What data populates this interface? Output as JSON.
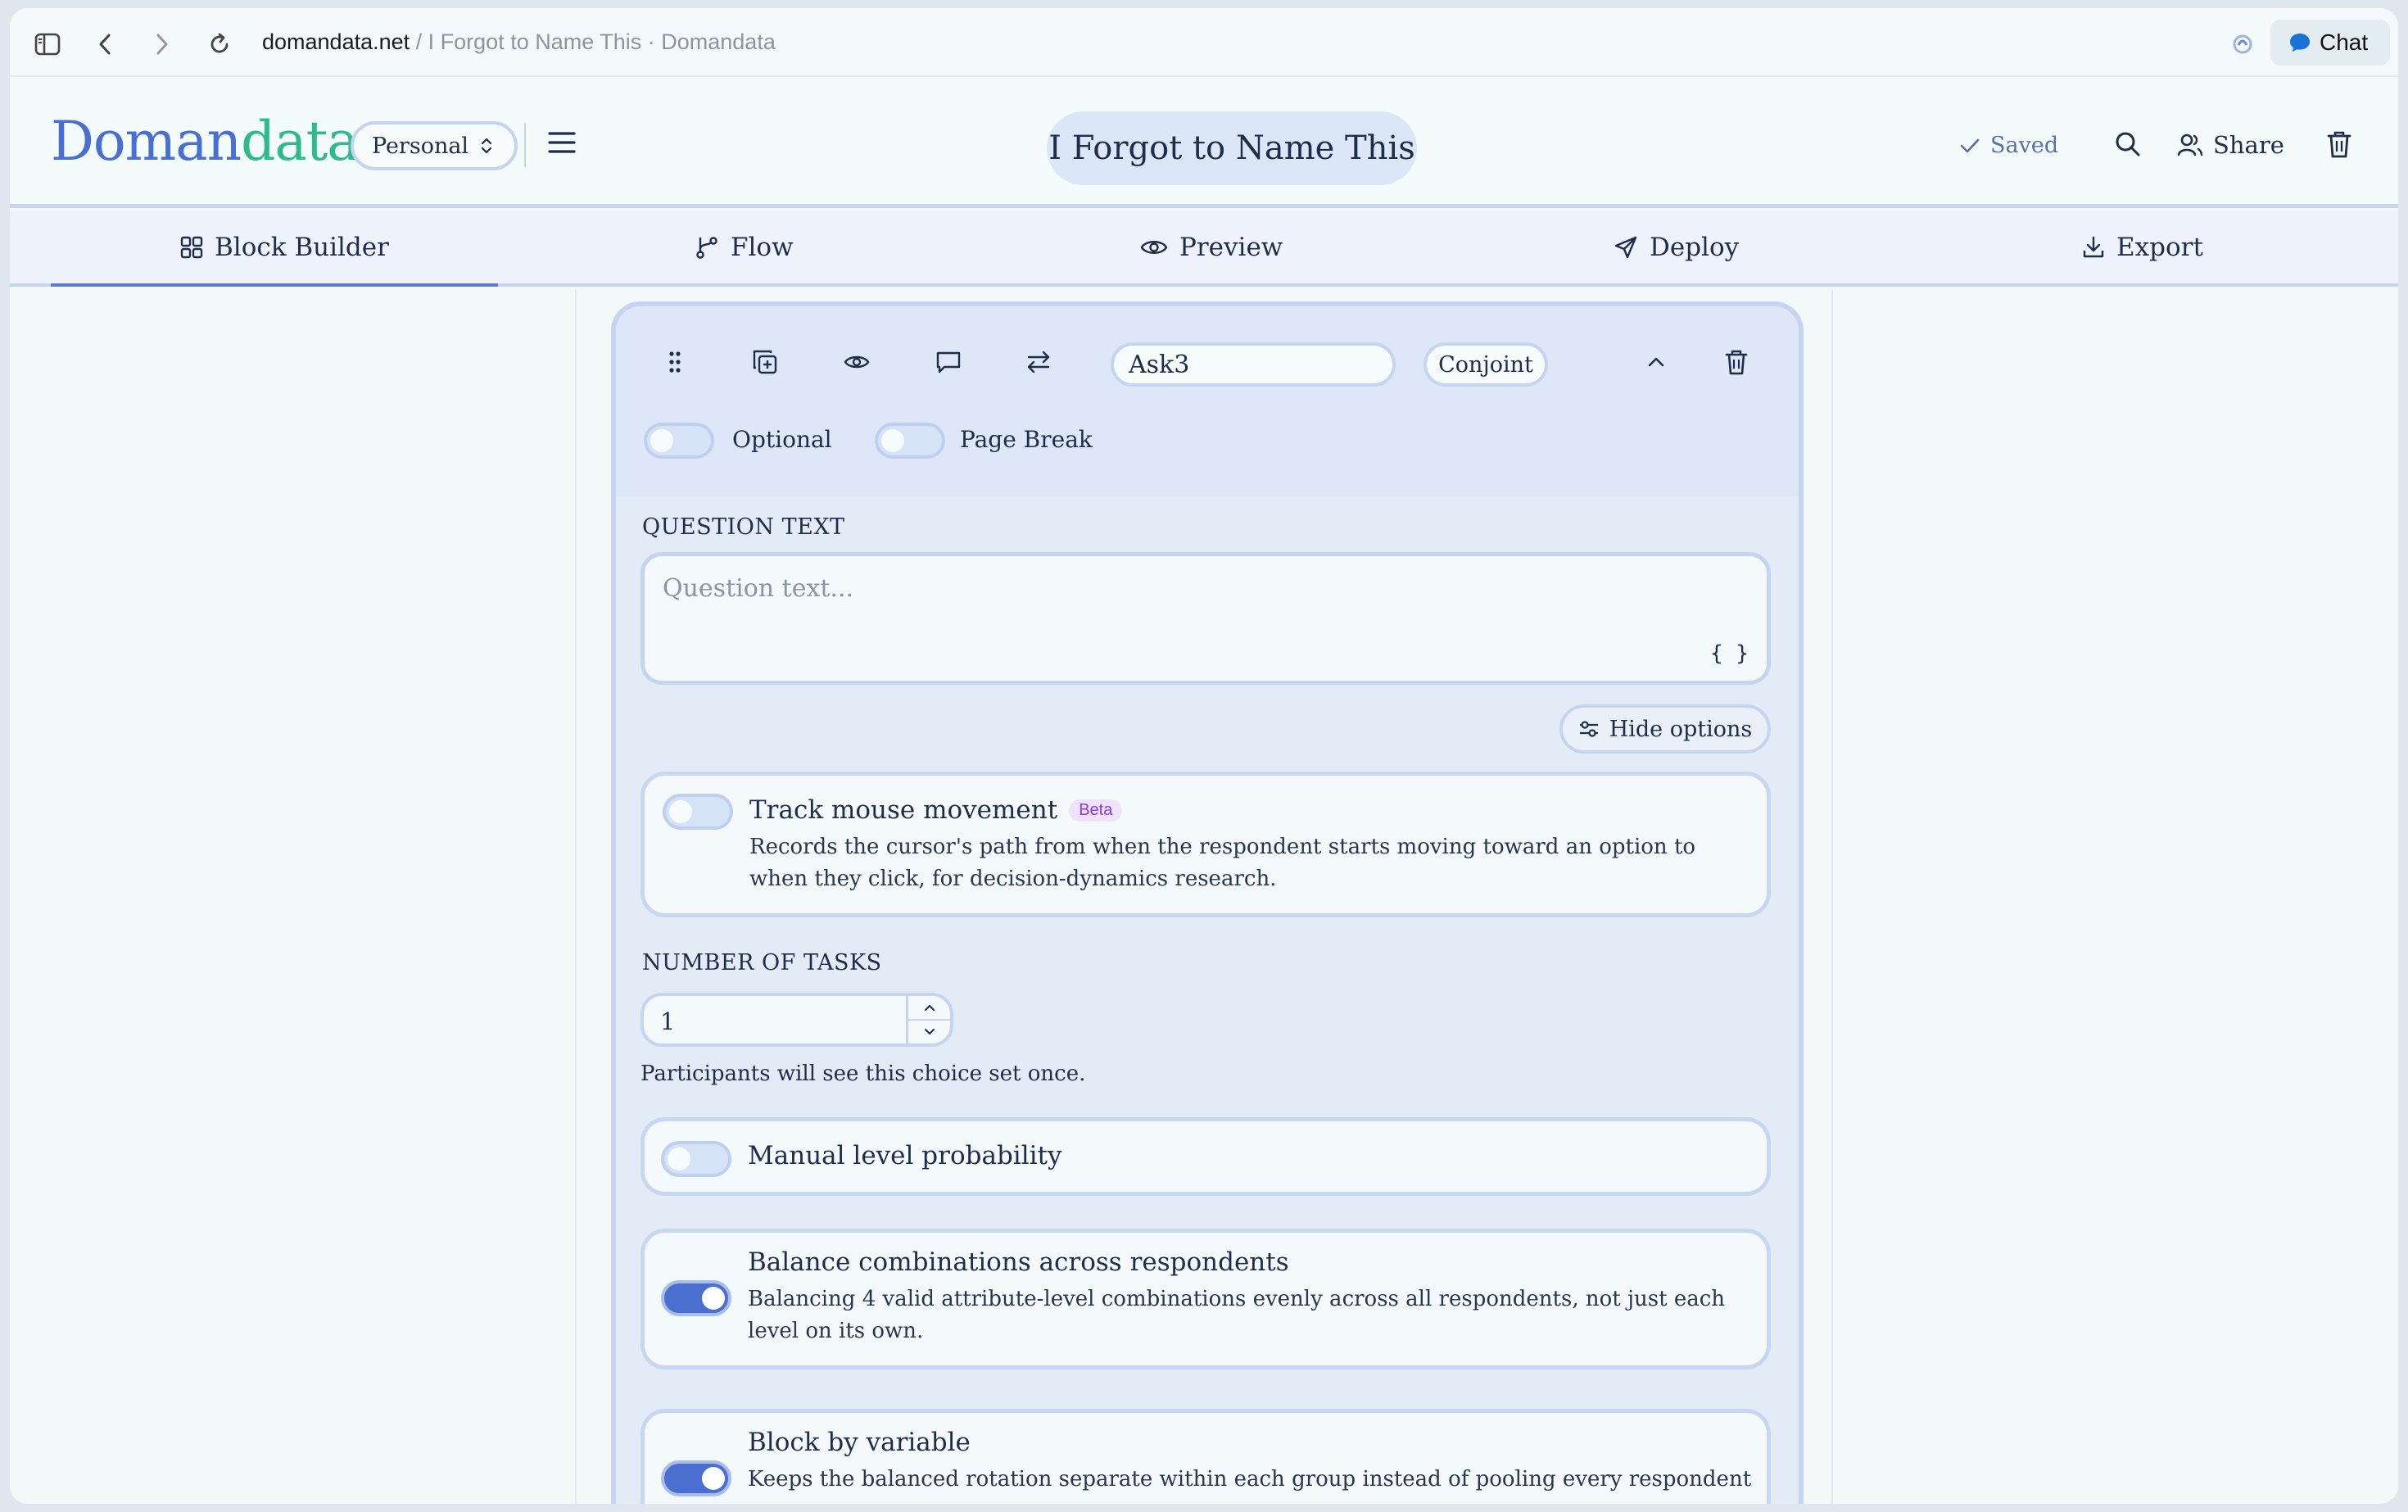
{
  "browser": {
    "url_domain": "domandata.net",
    "url_separator": " / ",
    "url_rest": "I Forgot to Name This · Domandata",
    "chat_label": "Chat"
  },
  "header": {
    "logo_part1": "Doman",
    "logo_part2": "data",
    "workspace": "Personal",
    "survey_title": "I Forgot to Name This",
    "saved_label": "Saved",
    "share_label": "Share"
  },
  "tabs": [
    {
      "label": "Block Builder",
      "icon": "grid-icon",
      "active": true
    },
    {
      "label": "Flow",
      "icon": "branch-icon",
      "active": false
    },
    {
      "label": "Preview",
      "icon": "eye-icon",
      "active": false
    },
    {
      "label": "Deploy",
      "icon": "send-icon",
      "active": false
    },
    {
      "label": "Export",
      "icon": "download-icon",
      "active": false
    }
  ],
  "block": {
    "name": "Ask3",
    "type": "Conjoint",
    "optional_label": "Optional",
    "optional_on": false,
    "page_break_label": "Page Break",
    "page_break_on": false,
    "question_text_label": "QUESTION TEXT",
    "question_placeholder": "Question text...",
    "variable_button": "{ }",
    "hide_options_label": "Hide options",
    "options": {
      "track_mouse": {
        "title": "Track mouse movement",
        "badge": "Beta",
        "desc": "Records the cursor's path from when the respondent starts moving toward an option to when they click, for decision-dynamics research.",
        "on": false
      },
      "tasks": {
        "label": "NUMBER OF TASKS",
        "value": "1",
        "help": "Participants will see this choice set once."
      },
      "manual_level": {
        "title": "Manual level probability",
        "on": false
      },
      "balance": {
        "title": "Balance combinations across respondents",
        "desc": "Balancing 4 valid attribute-level combinations evenly across all respondents, not just each level on its own.",
        "on": true
      },
      "block_by_var": {
        "title": "Block by variable",
        "desc": "Keeps the balanced rotation separate within each group instead of pooling every respondent",
        "on": true
      }
    }
  },
  "colors": {
    "accent": "#4a6fd0",
    "logo_green": "#2fba8c",
    "beta_purple": "#8a3ed6",
    "card_border": "#c4d4f1"
  }
}
